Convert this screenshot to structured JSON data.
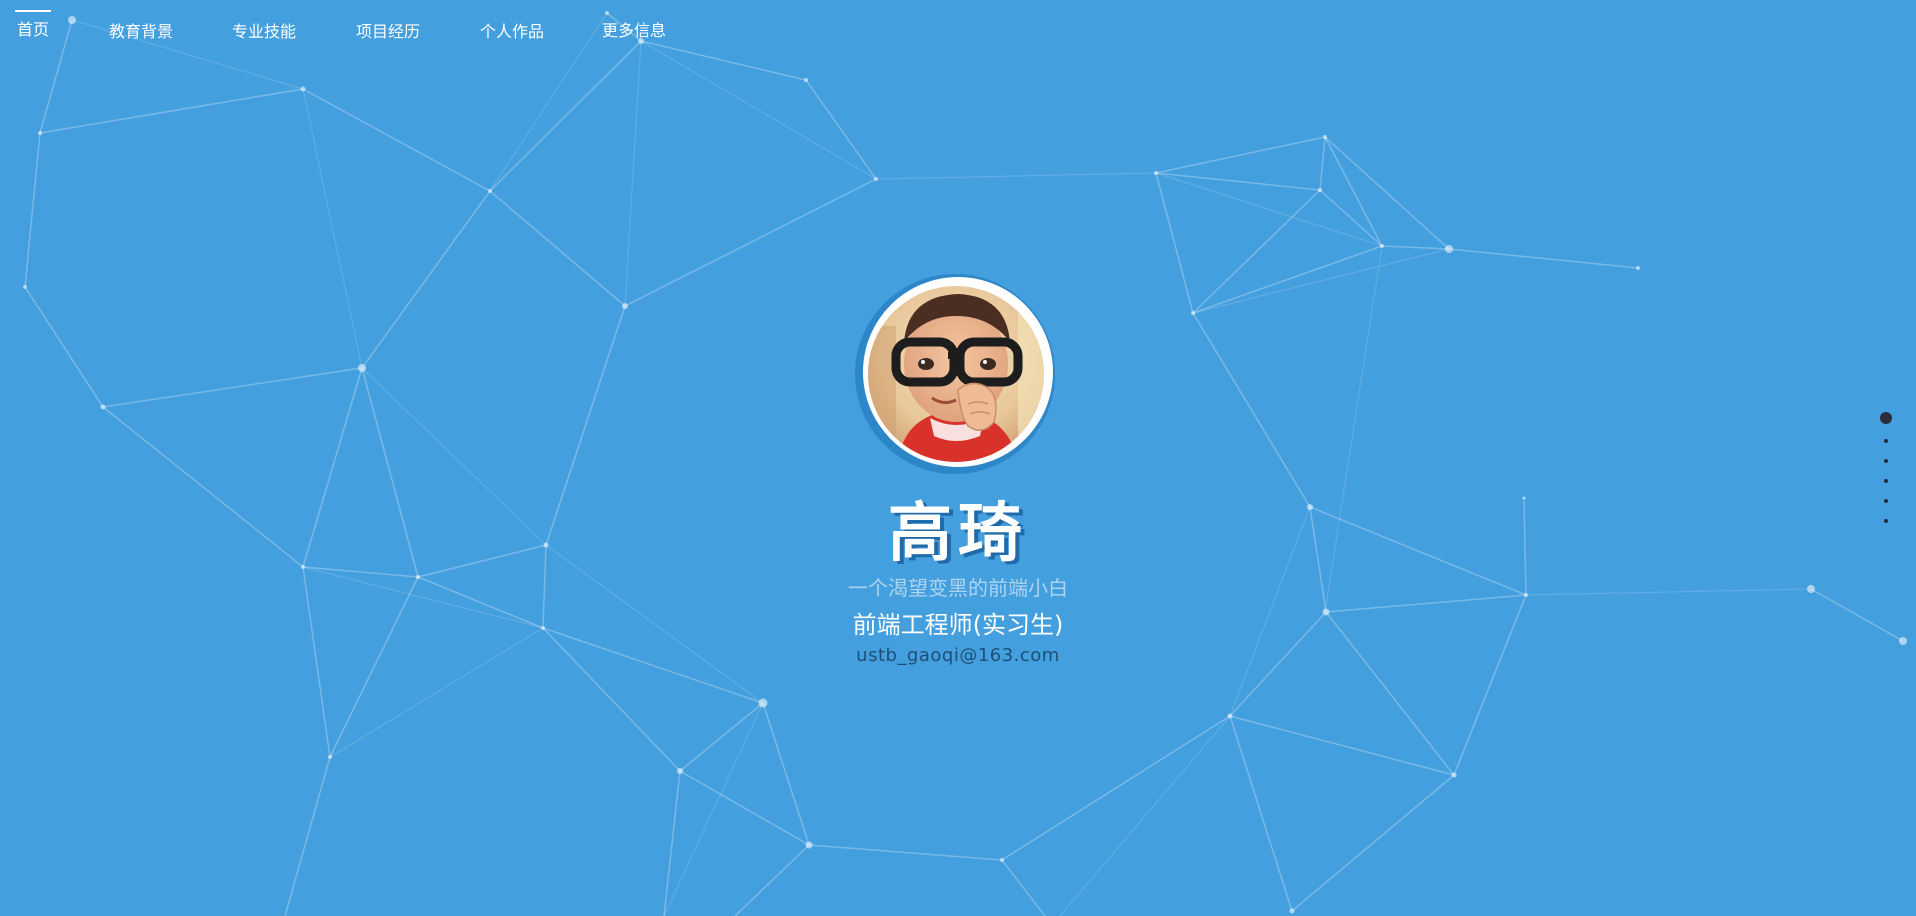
{
  "nav": {
    "items": [
      {
        "label": "首页",
        "active": true
      },
      {
        "label": "教育背景",
        "active": false
      },
      {
        "label": "专业技能",
        "active": false
      },
      {
        "label": "项目经历",
        "active": false
      },
      {
        "label": "个人作品",
        "active": false
      },
      {
        "label": "更多信息",
        "active": false
      }
    ]
  },
  "hero": {
    "name": "高琦",
    "motto": "一个渴望变黑的前端小白",
    "role": "前端工程师(实习生)",
    "email": "ustb_gaoqi@163.com",
    "avatar_icon": "avatar-photo-child-with-glasses"
  },
  "pagination": {
    "count": 6,
    "active_index": 0
  },
  "colors": {
    "background": "#449fde",
    "name_shadow": "#1f6aa8",
    "email": "#1e4f78",
    "dot": "#2b2b3a"
  }
}
